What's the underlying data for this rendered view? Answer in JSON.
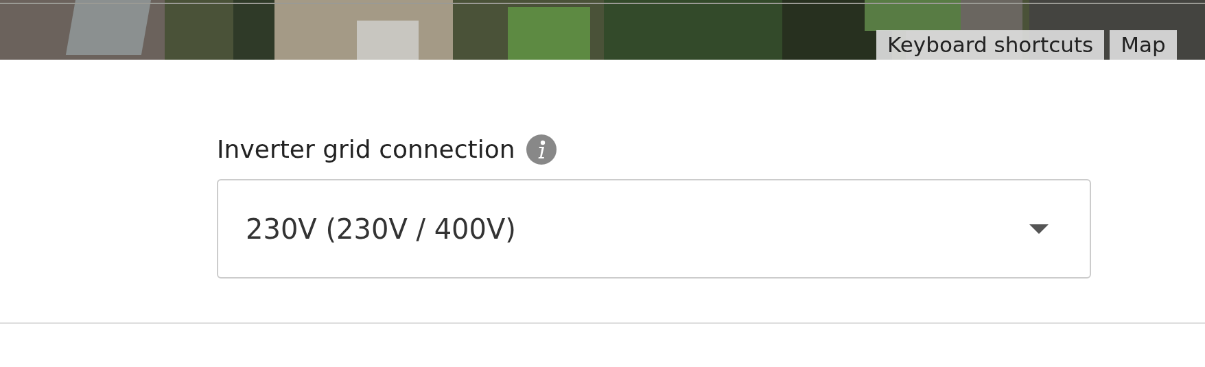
{
  "map": {
    "attribution_buttons": [
      "Keyboard shortcuts",
      "Map"
    ]
  },
  "field": {
    "label": "Inverter grid connection",
    "value": "230V (230V / 400V)"
  }
}
